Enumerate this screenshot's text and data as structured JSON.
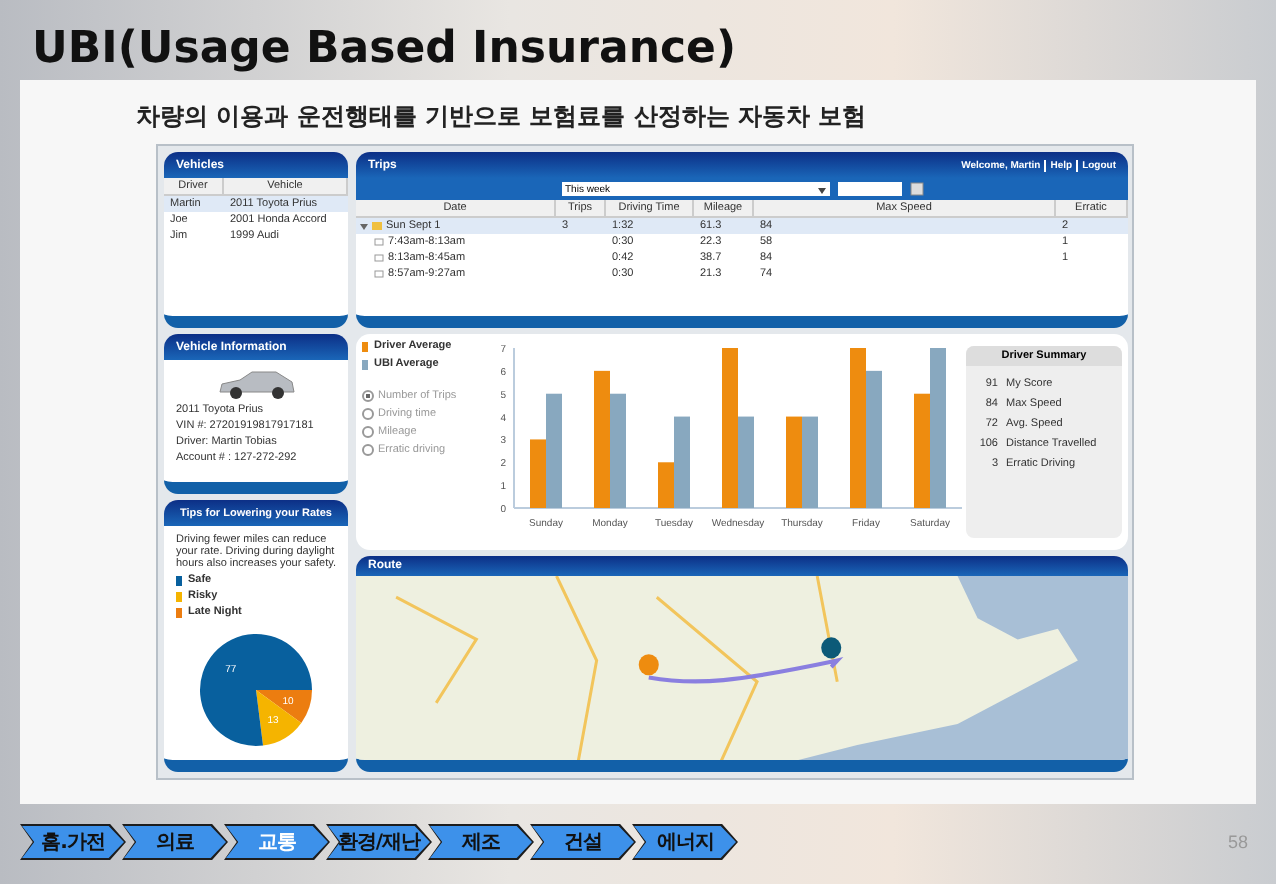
{
  "slide": {
    "title": "UBI(Usage Based Insurance)",
    "subtitle": "차량의 이용과 운전행태를 기반으로 보험료를 산정하는 자동차 보험",
    "page_number": "58"
  },
  "vehicles": {
    "title": "Vehicles",
    "columns": [
      "Driver",
      "Vehicle"
    ],
    "rows": [
      {
        "driver": "Martin",
        "vehicle": "2011 Toyota Prius",
        "selected": true
      },
      {
        "driver": "Joe",
        "vehicle": "2001 Honda Accord",
        "selected": false
      },
      {
        "driver": "Jim",
        "vehicle": "1999 Audi",
        "selected": false
      }
    ]
  },
  "trips": {
    "title": "Trips",
    "welcome": "Welcome, Martin",
    "links": [
      "Help",
      "Logout"
    ],
    "period": "This week",
    "columns": [
      "Date",
      "Trips",
      "Driving Time",
      "Mileage",
      "Max Speed",
      "Erratic"
    ],
    "rows": [
      {
        "date": "Sun Sept 1",
        "trips": "3",
        "driving_time": "1:32",
        "mileage": "61.3",
        "max_speed": "84",
        "erratic": "2",
        "expanded": true,
        "selected": true,
        "children": [
          {
            "date": "7:43am-8:13am",
            "driving_time": "0:30",
            "mileage": "22.3",
            "max_speed": "58",
            "erratic": "1",
            "selected": false
          },
          {
            "date": "8:13am-8:45am",
            "driving_time": "0:42",
            "mileage": "38.7",
            "max_speed": "84",
            "erratic": "1",
            "selected": false
          },
          {
            "date": "8:57am-9:27am",
            "driving_time": "0:30",
            "mileage": "21.3",
            "max_speed": "74",
            "selected": false
          }
        ]
      }
    ]
  },
  "vehicle_info": {
    "title": "Vehicle Information",
    "lines": [
      "2011 Toyota Prius",
      "VIN #: 27201919817917181",
      "Driver: Martin Tobias",
      "Account # : 127-272-292"
    ]
  },
  "tips": {
    "title": "Tips for Lowering your Rates",
    "text": "Driving fewer miles can reduce your rate. Driving during daylight hours also increases your safety.",
    "chart_data": {
      "type": "pie",
      "categories": [
        "Safe",
        "Risky",
        "Late Night"
      ],
      "series": [
        {
          "values": [
            77,
            13,
            10
          ]
        }
      ],
      "data_labels": true
    }
  },
  "chart": {
    "options": [
      {
        "label": "Number of Trips",
        "selected": true
      },
      {
        "label": "Driving time",
        "selected": false
      },
      {
        "label": "Mileage",
        "selected": false
      },
      {
        "label": "Erratic driving",
        "selected": false
      }
    ],
    "chart_data": {
      "type": "bar",
      "categories": [
        "Sunday",
        "Monday",
        "Tuesday",
        "Wednesday",
        "Thursday",
        "Friday",
        "Saturday"
      ],
      "series": [
        {
          "name": "Driver Average",
          "color": "#ee8c0f",
          "values": [
            3,
            6,
            2,
            7,
            4,
            7,
            5
          ]
        },
        {
          "name": "UBI Average",
          "color": "#88a8bf",
          "values": [
            5,
            5,
            4,
            4,
            4,
            6,
            7
          ]
        }
      ],
      "ylim": [
        0,
        7
      ],
      "yticks": [
        0,
        1,
        2,
        3,
        4,
        5,
        6,
        7
      ]
    },
    "summary": {
      "title": "Driver Summary",
      "items": [
        {
          "number": "91",
          "metric": "My Score"
        },
        {
          "number": "84",
          "metric": "Max Speed"
        },
        {
          "number": "72",
          "metric": "Avg. Speed"
        },
        {
          "number": "106",
          "metric": "Distance Travelled"
        },
        {
          "number": "3",
          "metric": "Erratic Driving"
        }
      ]
    }
  },
  "route": {
    "title": "Route"
  },
  "nav": [
    {
      "label": "홈.가전",
      "selected": false
    },
    {
      "label": "의료",
      "selected": false
    },
    {
      "label": "교통",
      "selected": true
    },
    {
      "label": "환경/재난",
      "selected": false
    },
    {
      "label": "제조",
      "selected": false
    },
    {
      "label": "건설",
      "selected": false
    },
    {
      "label": "에너지",
      "selected": false
    }
  ]
}
